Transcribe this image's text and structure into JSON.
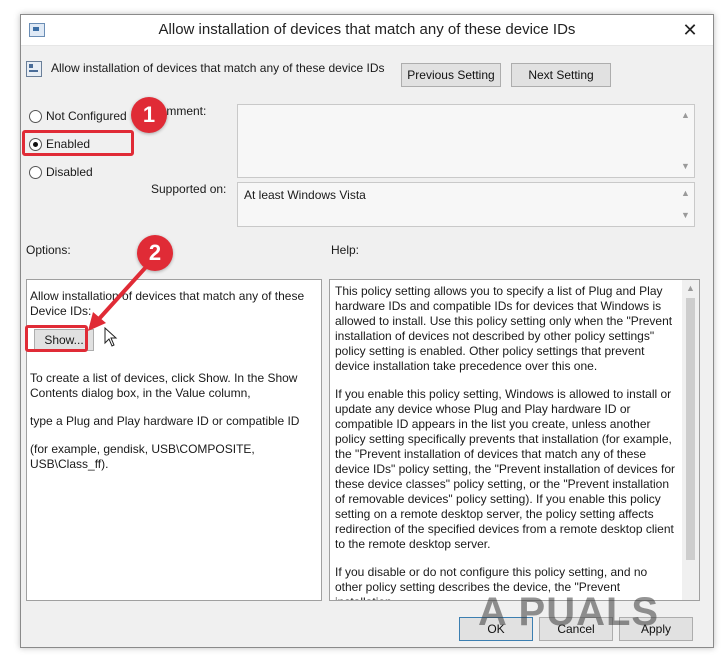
{
  "window": {
    "title": "Allow installation of devices that match any of these device IDs",
    "close_glyph": "✕"
  },
  "header": {
    "setting_name": "Allow installation of devices that match any of these device IDs",
    "previous_label": "Previous Setting",
    "next_label": "Next Setting"
  },
  "state": {
    "options": [
      {
        "label": "Not Configured",
        "checked": false
      },
      {
        "label": "Enabled",
        "checked": true
      },
      {
        "label": "Disabled",
        "checked": false
      }
    ]
  },
  "comment": {
    "label": "Comment:",
    "value": ""
  },
  "supported": {
    "label": "Supported on:",
    "value": "At least Windows Vista"
  },
  "options_section": {
    "heading": "Options:",
    "description": "Allow installation of devices that match any of these Device IDs:",
    "show_label": "Show...",
    "instruction_1": "To create a list of devices, click Show. In the Show Contents dialog box, in the Value column,",
    "instruction_2": "type a Plug and Play hardware ID or compatible ID",
    "instruction_3": "(for example, gendisk, USB\\COMPOSITE, USB\\Class_ff)."
  },
  "help_section": {
    "heading": "Help:",
    "paragraph_1": "This policy setting allows you to specify a list of Plug and Play hardware IDs and compatible IDs for devices that Windows is allowed to install. Use this policy setting only when the \"Prevent installation of devices not described by other policy settings\" policy setting is enabled. Other policy settings that prevent device installation take precedence over this one.",
    "paragraph_2": "If you enable this policy setting, Windows is allowed to install or update any device whose Plug and Play hardware ID or compatible ID appears in the list you create, unless another policy setting specifically prevents that installation (for example, the \"Prevent installation of devices that match any of these device IDs\" policy setting, the \"Prevent installation of devices for these device classes\" policy setting, or the \"Prevent installation of removable devices\" policy setting). If you enable this policy setting on a remote desktop server, the policy setting affects redirection of the specified devices from a remote desktop client to the remote desktop server.",
    "paragraph_3": "If you disable or do not configure this policy setting, and no other policy setting describes the device, the \"Prevent installation"
  },
  "footer": {
    "ok_label": "OK",
    "cancel_label": "Cancel",
    "apply_label": "Apply"
  },
  "annotations": {
    "step_1": "1",
    "step_2": "2",
    "color": "#e02b36"
  },
  "watermark": "A PUALS",
  "icons": [
    "app-icon",
    "setting-icon",
    "close-icon",
    "scroll-up-icon",
    "scroll-down-icon",
    "cursor-icon",
    "arrow-annotation-icon"
  ]
}
